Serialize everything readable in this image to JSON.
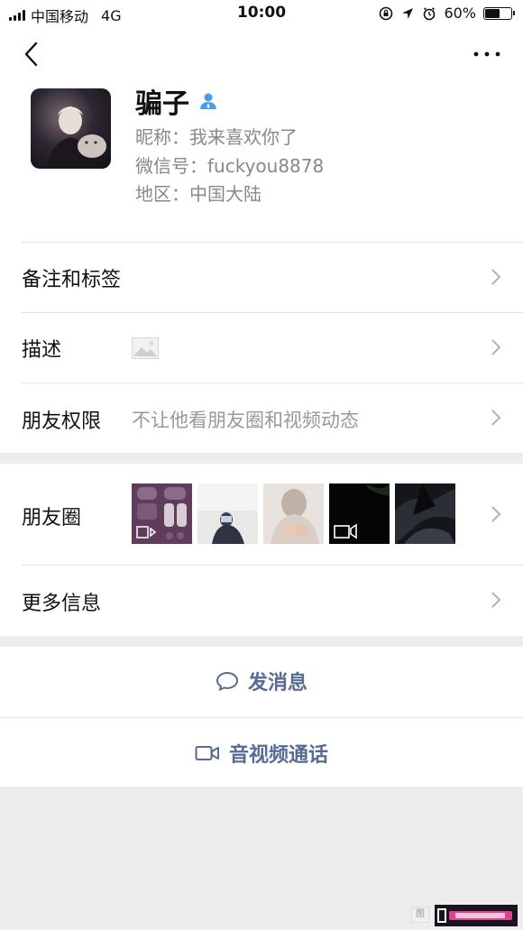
{
  "status_bar": {
    "carrier": "中国移动",
    "network": "4G",
    "time": "10:00",
    "battery": "60%",
    "battery_level": 0.6
  },
  "profile": {
    "name": "骗子",
    "nickname_label": "昵称：",
    "nickname": "我来喜欢你了",
    "wechat_id_label": "微信号：",
    "wechat_id": "fuckyou8878",
    "region_label": "地区：",
    "region": "中国大陆"
  },
  "rows": {
    "remark": "备注和标签",
    "description": "描述",
    "permissions": "朋友权限",
    "permissions_value": "不让他看朋友圈和视频动态",
    "moments": "朋友圈",
    "more_info": "更多信息"
  },
  "actions": {
    "message": "发消息",
    "call": "音视频通话"
  },
  "colors": {
    "link_blue": "#576b95",
    "verified_blue": "#4c9be8",
    "background": "#ededed"
  },
  "icons": {
    "back": "chevron-left-icon",
    "more": "more-dots-icon",
    "verified": "person-icon",
    "image_placeholder": "image-icon",
    "chat": "chat-bubble-icon",
    "video": "video-camera-icon"
  }
}
